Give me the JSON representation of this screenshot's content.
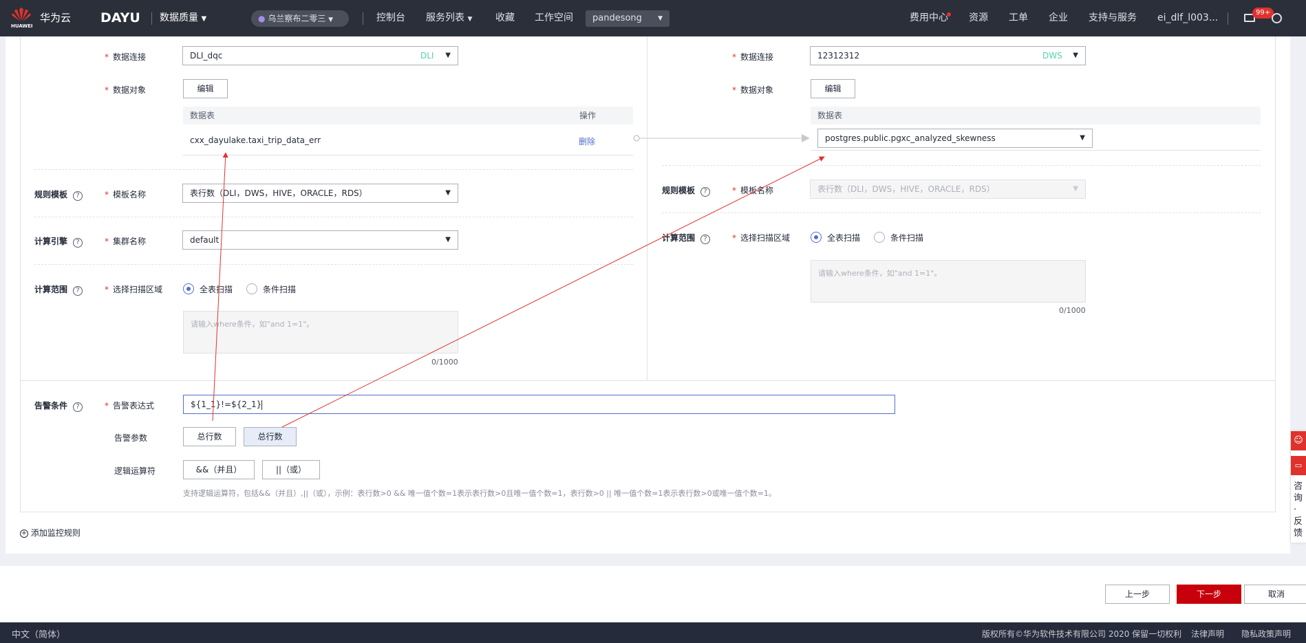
{
  "topbar": {
    "brand": "华为云",
    "logo_sub": "HUAWEI",
    "product": "DAYU",
    "module": "数据质量",
    "region": "乌兰察布二零三",
    "nav": [
      "控制台",
      "服务列表",
      "收藏",
      "工作空间"
    ],
    "workspace": "pandesong",
    "right": [
      "费用中心",
      "资源",
      "工单",
      "企业",
      "支持与服务",
      "ei_dlf_l003..."
    ],
    "msg_badge": "99+"
  },
  "left": {
    "conn_label": "数据连接",
    "conn_value": "DLI_dqc",
    "conn_type": "DLI",
    "obj_label": "数据对象",
    "edit_btn": "编辑",
    "table_col": "数据表",
    "op_col": "操作",
    "table_row": "cxx_dayulake.taxi_trip_data_err",
    "delete_link": "删除",
    "rule_section": "规则模板",
    "tpl_label": "模板名称",
    "tpl_value": "表行数（DLI，DWS，HIVE，ORACLE，RDS）",
    "engine_section": "计算引擎",
    "cluster_label": "集群名称",
    "cluster_value": "default",
    "scope_section": "计算范围",
    "scan_label": "选择扫描区域",
    "full_scan": "全表扫描",
    "cond_scan": "条件扫描",
    "where_placeholder": "请输入where条件，如\"and 1=1\"。",
    "counter": "0/1000"
  },
  "right": {
    "conn_label": "数据连接",
    "conn_value": "12312312",
    "conn_type": "DWS",
    "obj_label": "数据对象",
    "edit_btn": "编辑",
    "table_col": "数据表",
    "table_value": "postgres.public.pgxc_analyzed_skewness",
    "rule_section": "规则模板",
    "tpl_label": "模板名称",
    "tpl_value": "表行数（DLI，DWS，HIVE，ORACLE，RDS）",
    "scope_section": "计算范围",
    "scan_label": "选择扫描区域",
    "full_scan": "全表扫描",
    "cond_scan": "条件扫描",
    "where_placeholder": "请输入where条件，如\"and 1=1\"。",
    "counter": "0/1000"
  },
  "alarm": {
    "section": "告警条件",
    "expr_label": "告警表达式",
    "expr_value": "${1_1}!=${2_1}",
    "param_label": "告警参数",
    "params": [
      "总行数",
      "总行数"
    ],
    "logic_label": "逻辑运算符",
    "and_btn": "&&（并且）",
    "or_btn": "||（或）",
    "hint": "支持逻辑运算符，包括&&（并且）,||（或），示例：表行数>0 && 唯一值个数=1表示表行数>0且唯一值个数=1，表行数>0 || 唯一值个数=1表示表行数>0或唯一值个数=1。"
  },
  "add_rule": "添加监控规则",
  "actions": {
    "prev": "上一步",
    "next": "下一步",
    "cancel": "取消"
  },
  "side_float": "咨询·反馈",
  "bottom": {
    "lang": "中文（简体）",
    "copyright": "版权所有©华为软件技术有限公司 2020 保留一切权利",
    "legal": "法律声明",
    "privacy": "隐私政策声明"
  },
  "colors": {
    "topbar": "#2b2f3a",
    "primary": "#c7000b",
    "link": "#526ecc",
    "annotation": "#e0322d"
  }
}
